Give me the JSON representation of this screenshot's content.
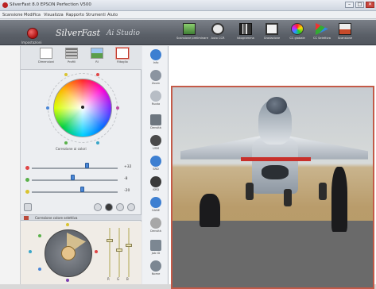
{
  "window": {
    "title": "SilverFast 8.0 EPSON Perfection V500",
    "buttons": [
      "–",
      "□",
      "✕"
    ]
  },
  "menu": [
    "Scansione",
    "Modifica",
    "Visualizza",
    "Rapporto",
    "Strumenti",
    "Aiuto"
  ],
  "brand": {
    "logo_icon": "silverfast-logo-icon",
    "name": "SilverFast",
    "edition": "Ai Studio",
    "caption": "Impostazioni"
  },
  "toolbar": [
    {
      "icon": "prescan-icon",
      "label": "Scansione preliminare",
      "color": "#5aa357"
    },
    {
      "icon": "auto-icon",
      "label": "Auto CCR",
      "color": "#333333"
    },
    {
      "icon": "histogram-icon",
      "label": "Istogramma",
      "color": "#2a2a2a"
    },
    {
      "icon": "gradation-icon",
      "label": "Gradazione",
      "color": "#3a3a3a"
    },
    {
      "icon": "color-circle-icon",
      "label": "CC globale",
      "color": "#d04a8a"
    },
    {
      "icon": "selective-icon",
      "label": "CC Selettiva",
      "color": "#4a90d9"
    },
    {
      "icon": "scan-icon",
      "label": "Scansione",
      "color": "#c74a2a"
    }
  ],
  "tabs": [
    {
      "icon": "doc-icon",
      "label": "Dimensioni"
    },
    {
      "icon": "film-icon",
      "label": "Profili"
    },
    {
      "icon": "image-icon",
      "label": "RI"
    },
    {
      "icon": "figure-icon",
      "label": "Ritaglio",
      "active": true
    }
  ],
  "wheel_caption": "Correzione ai colori",
  "sliders": [
    {
      "label_color": "#e04646",
      "value": "+32",
      "pos": 0.63
    },
    {
      "label_color": "#5ab14a",
      "value": "-8",
      "pos": 0.46
    },
    {
      "label_color": "#d9c330",
      "value": "-20",
      "pos": 0.57
    }
  ],
  "section2": {
    "title": "Correzione colore selettiva",
    "vsliders": [
      {
        "label": "R"
      },
      {
        "label": "G"
      },
      {
        "label": "B"
      }
    ]
  },
  "middle_tools": [
    {
      "icon": "info-icon",
      "label": "Info",
      "color": "#3d7fd1"
    },
    {
      "icon": "zoom-icon",
      "label": "Zoom",
      "color": "#8b94a0"
    },
    {
      "icon": "rotate-icon",
      "label": "Ruota",
      "color": "#b7bdc5"
    },
    {
      "icon": "densitometer-icon",
      "label": "Densità",
      "color": "#6d767f"
    },
    {
      "icon": "midtone-icon",
      "label": "USM",
      "color": "#4a4a4a"
    },
    {
      "icon": "noise-icon",
      "label": "SRD",
      "color": "#3d7fd1"
    },
    {
      "icon": "dust-icon",
      "label": "iSRD",
      "color": "#3a3a3a"
    },
    {
      "icon": "gang-icon",
      "label": "GANE",
      "color": "#3d7fd1"
    },
    {
      "icon": "exposure-icon",
      "label": "Densità",
      "color": "#a7a7a7"
    },
    {
      "icon": "crop-icon",
      "label": "Job ID",
      "color": "#7c8792"
    },
    {
      "icon": "settings-icon",
      "label": "Nome",
      "color": "#7c8792"
    }
  ]
}
